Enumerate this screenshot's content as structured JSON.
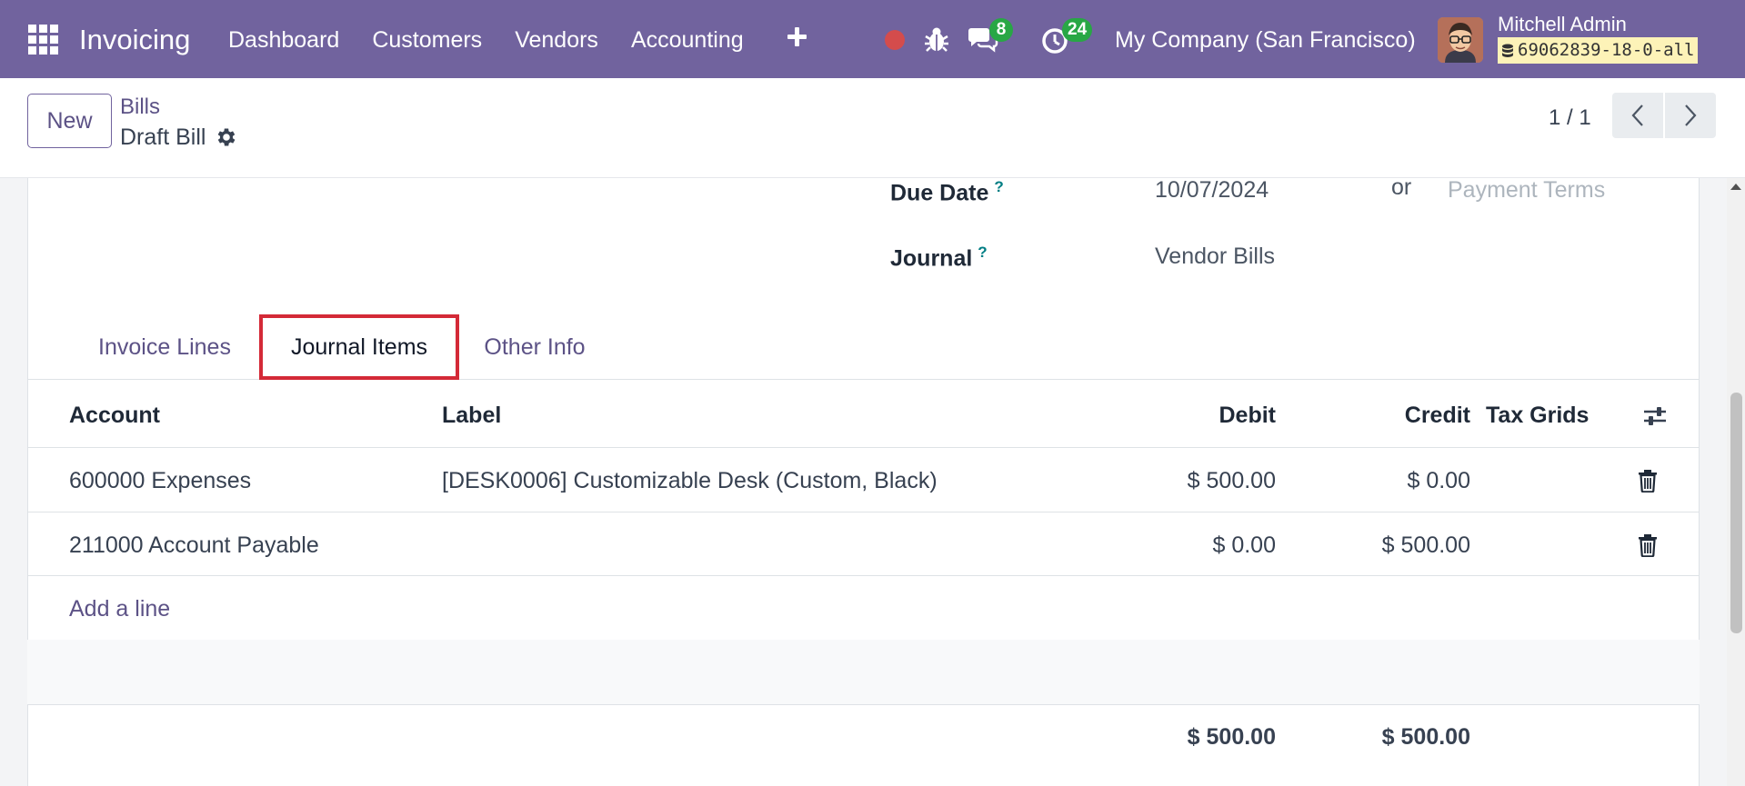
{
  "navbar": {
    "app_name": "Invoicing",
    "menu": [
      "Dashboard",
      "Customers",
      "Vendors",
      "Accounting"
    ],
    "messages_count": "8",
    "activities_count": "24",
    "company": "My Company (San Francisco)",
    "user_name": "Mitchell Admin",
    "database": "69062839-18-0-all",
    "color": "#71639e"
  },
  "control_panel": {
    "new_label": "New",
    "breadcrumb_parent": "Bills",
    "breadcrumb_current": "Draft Bill",
    "pager": "1 / 1"
  },
  "form": {
    "due_date_label": "Due Date",
    "due_date_help": "?",
    "due_date_value": "10/07/2024",
    "or_label": "or",
    "payment_terms_placeholder": "Payment Terms",
    "journal_label": "Journal",
    "journal_help": "?",
    "journal_value": "Vendor Bills"
  },
  "tabs": [
    {
      "label": "Invoice Lines",
      "active": false
    },
    {
      "label": "Journal Items",
      "active": true
    },
    {
      "label": "Other Info",
      "active": false
    }
  ],
  "table": {
    "columns": [
      "Account",
      "Label",
      "Debit",
      "Credit",
      "Tax Grids"
    ],
    "rows": [
      {
        "account": "600000 Expenses",
        "label": "[DESK0006] Customizable Desk (Custom, Black)",
        "debit": "$ 500.00",
        "credit": "$ 0.00",
        "tax_grids": ""
      },
      {
        "account": "211000 Account Payable",
        "label": "",
        "debit": "$ 0.00",
        "credit": "$ 500.00",
        "tax_grids": ""
      }
    ],
    "add_line": "Add a line",
    "total_debit": "$ 500.00",
    "total_credit": "$ 500.00"
  },
  "colors": {
    "brand": "#71639e",
    "highlight": "#d42a37",
    "badge": "#28a745",
    "record": "#d44c4c"
  }
}
